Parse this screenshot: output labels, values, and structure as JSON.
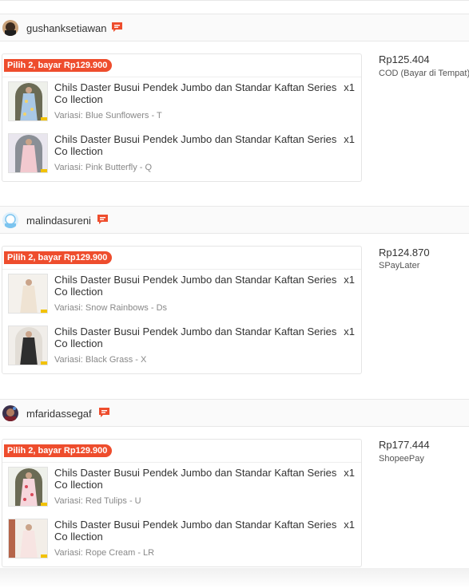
{
  "orders": [
    {
      "username": "gushanksetiawan",
      "promo": "Pilih 2, bayar Rp129.900",
      "price": "Rp125.404",
      "payment": "COD (Bayar di Tempat)",
      "items": [
        {
          "title": "Chils Daster Busui Pendek Jumbo dan Standar Kaftan Series Co llection",
          "qty": "x1",
          "variant": "Variasi: Blue Sunflowers - T"
        },
        {
          "title": "Chils Daster Busui Pendek Jumbo dan Standar Kaftan Series Co llection",
          "qty": "x1",
          "variant": "Variasi: Pink Butterfly - Q"
        }
      ]
    },
    {
      "username": "malindasureni",
      "promo": "Pilih 2, bayar Rp129.900",
      "price": "Rp124.870",
      "payment": "SPayLater",
      "items": [
        {
          "title": "Chils Daster Busui Pendek Jumbo dan Standar Kaftan Series Co llection",
          "qty": "x1",
          "variant": "Variasi: Snow Rainbows - Ds"
        },
        {
          "title": "Chils Daster Busui Pendek Jumbo dan Standar Kaftan Series Co llection",
          "qty": "x1",
          "variant": "Variasi: Black Grass - X"
        }
      ]
    },
    {
      "username": "mfaridassegaf",
      "promo": "Pilih 2, bayar Rp129.900",
      "price": "Rp177.444",
      "payment": "ShopeePay",
      "items": [
        {
          "title": "Chils Daster Busui Pendek Jumbo dan Standar Kaftan Series Co llection",
          "qty": "x1",
          "variant": "Variasi: Red Tulips - U"
        },
        {
          "title": "Chils Daster Busui Pendek Jumbo dan Standar Kaftan Series Co llection",
          "qty": "x1",
          "variant": "Variasi: Rope Cream - LR"
        }
      ]
    }
  ],
  "colors": {
    "accent": "#ee4d2d",
    "border": "#e5e5e5",
    "header_bg": "#fafafa"
  },
  "icons": {
    "chat": "chat-icon"
  }
}
